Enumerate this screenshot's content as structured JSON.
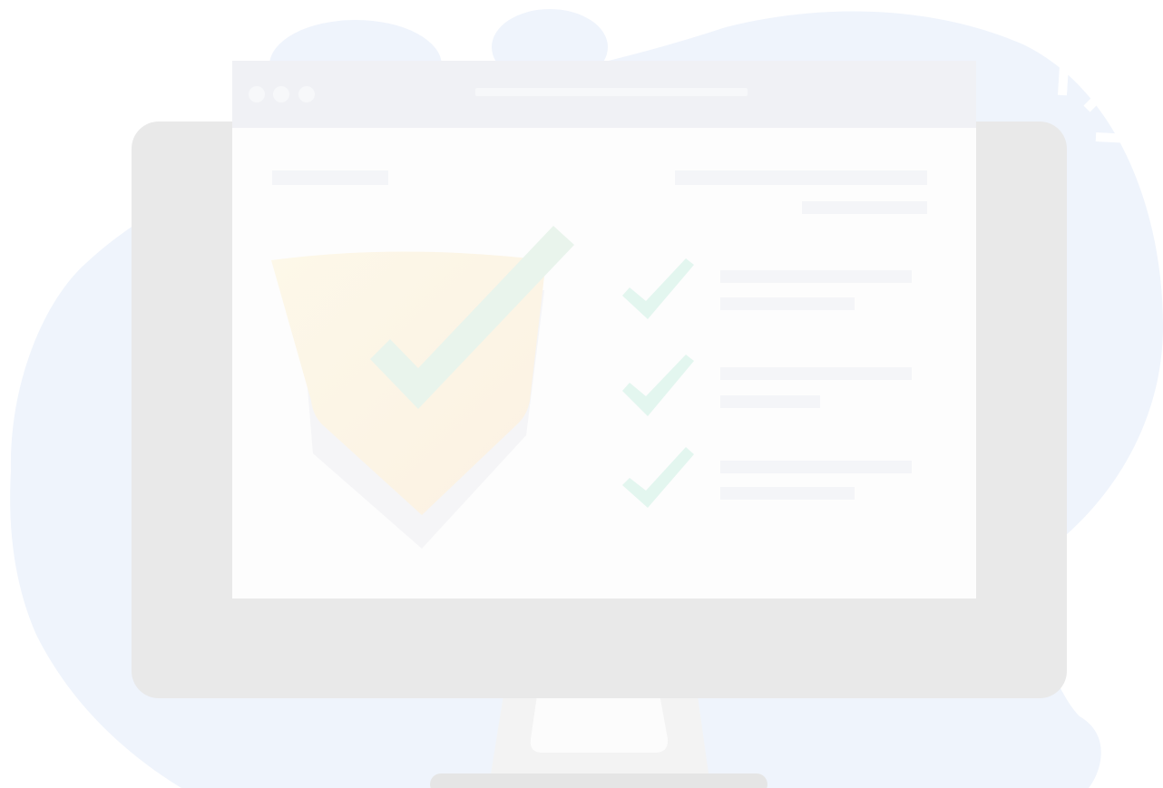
{
  "illustration": {
    "subject": "desktop-monitor-security-checklist",
    "colors": {
      "background": "#ffffff",
      "blob": "#eff4fc",
      "monitor_bezel": "#e9e9e9",
      "monitor_stand": "#f3f3f3",
      "monitor_stand_base": "#e5e5e5",
      "browser_bar": "#f0f1f5",
      "browser_dot": "#f7f8fa",
      "screen": "#fdfdfd",
      "placeholder_line": "#f4f5f8",
      "shield_yellow": "#fdf8e9",
      "shield_orange": "#fbf1e2",
      "shield_shadow": "#f3f3f5",
      "check_green": "#e9f4ec",
      "check_mint": "#e3f6ef",
      "sparkle": "#ffffff"
    },
    "icons": [
      "shield-check-icon",
      "check-icon",
      "check-icon",
      "check-icon",
      "sparkle-icon"
    ],
    "checklist_items": [
      {
        "checked": true
      },
      {
        "checked": true
      },
      {
        "checked": true
      }
    ]
  }
}
